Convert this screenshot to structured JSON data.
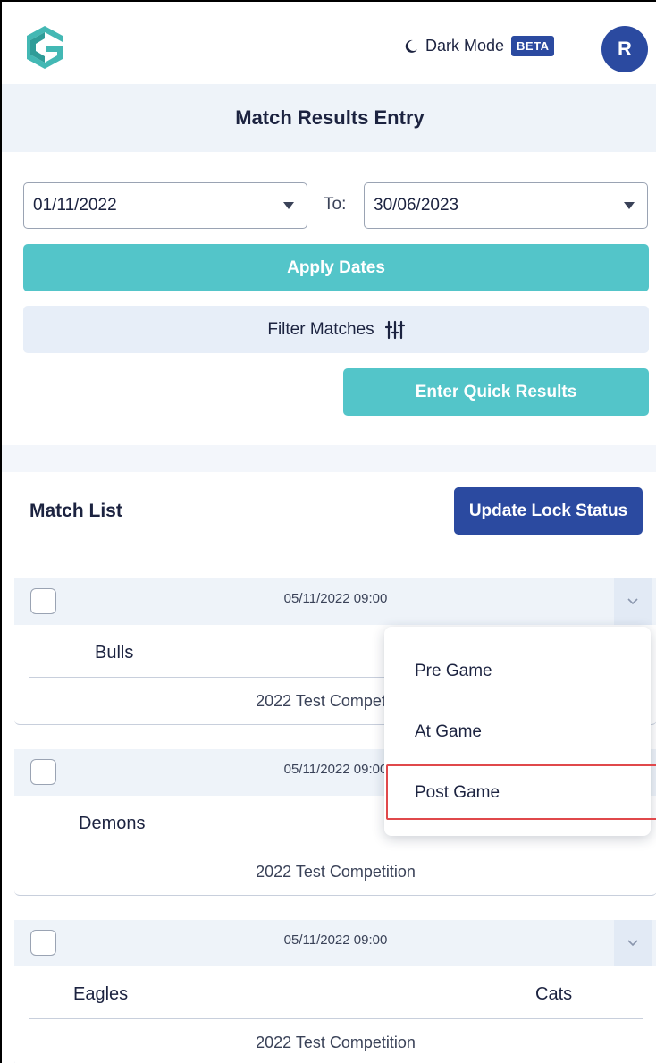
{
  "header": {
    "dark_mode_label": "Dark Mode",
    "beta_badge": "BETA",
    "avatar_initial": "R",
    "logo_icon": "brand-g-logo-icon",
    "moon_icon": "moon-icon"
  },
  "page": {
    "title": "Match Results Entry"
  },
  "dates": {
    "from_value": "01/11/2022",
    "to_label": "To:",
    "to_value": "30/06/2023",
    "apply_label": "Apply Dates"
  },
  "filter": {
    "label": "Filter Matches",
    "icon": "sliders-icon"
  },
  "quick_results_label": "Enter Quick Results",
  "match_list": {
    "title": "Match List",
    "update_lock_label": "Update Lock Status",
    "matches": [
      {
        "datetime": "05/11/2022 09:00",
        "home": "Bulls",
        "away": "",
        "competition": "2022 Test Competition"
      },
      {
        "datetime": "05/11/2022 09:00",
        "home": "Demons",
        "away": "",
        "competition": "2022 Test Competition"
      },
      {
        "datetime": "05/11/2022 09:00",
        "home": "Eagles",
        "away": "Cats",
        "competition": "2022 Test Competition"
      }
    ]
  },
  "status_menu": {
    "items": [
      "Pre Game",
      "At Game",
      "Post Game"
    ],
    "highlighted": "Post Game"
  },
  "colors": {
    "primary": "#2b4aa0",
    "accent_teal": "#53c5c9",
    "panel_bg": "#eef3f9",
    "highlight_border": "#e0484b"
  }
}
